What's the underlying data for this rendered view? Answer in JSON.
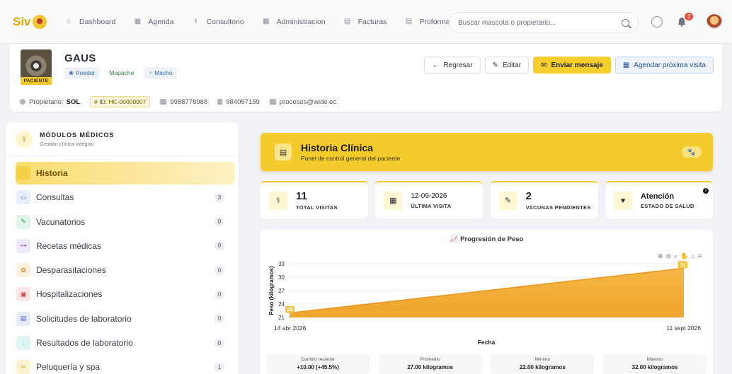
{
  "app": {
    "logo_text": "Siv"
  },
  "nav": {
    "items": [
      {
        "label": "Dashboard",
        "icon": "home-icon"
      },
      {
        "label": "Agenda",
        "icon": "calendar-icon"
      },
      {
        "label": "Consultorio",
        "icon": "doctor-icon"
      },
      {
        "label": "Administracion",
        "icon": "grid-icon"
      },
      {
        "label": "Facturas",
        "icon": "file-icon"
      },
      {
        "label": "Proformas",
        "icon": "file-icon"
      }
    ],
    "search_placeholder": "Buscar mascota o propietario...",
    "notifications_count": "2"
  },
  "patient": {
    "name": "GAUS",
    "tag": "PACIENTE",
    "chips": {
      "species": "Roedor",
      "breed": "Mapache",
      "sex": "Macho"
    },
    "owner_label": "Propietario:",
    "owner_name": "SOL",
    "id": "ID: HC-00000007",
    "phone1": "9988778988",
    "phone2": "984057159",
    "email": "procesos@wide.ec"
  },
  "actions": {
    "back": "Regresar",
    "edit": "Editar",
    "message": "Enviar mensaje",
    "schedule": "Agendar próxima visita"
  },
  "sidebar": {
    "title": "MÓDULOS MÉDICOS",
    "subtitle": "Gestión clínica integral",
    "items": [
      {
        "label": "Historia",
        "count": "",
        "color": "#f3cb2c",
        "bg": "#f6d24a"
      },
      {
        "label": "Consultas",
        "count": "3",
        "color": "#3f6fd1",
        "bg": "#e7eefc"
      },
      {
        "label": "Vacunatorios",
        "count": "0",
        "color": "#2e9d5b",
        "bg": "#e3f5ea"
      },
      {
        "label": "Recetas médicas",
        "count": "0",
        "color": "#7a4fd0",
        "bg": "#efe8fb"
      },
      {
        "label": "Desparasitaciones",
        "count": "0",
        "color": "#d98a1c",
        "bg": "#fdf0de"
      },
      {
        "label": "Hospitalizaciones",
        "count": "0",
        "color": "#d64545",
        "bg": "#fde6e6"
      },
      {
        "label": "Solicitudes de laboratorio",
        "count": "0",
        "color": "#4b5fd6",
        "bg": "#e8ebfb"
      },
      {
        "label": "Resultados de laboratorio",
        "count": "0",
        "color": "#2b9fa3",
        "bg": "#e1f4f4"
      },
      {
        "label": "Peluquería y spa",
        "count": "1",
        "color": "#c9a400",
        "bg": "#fbf3cf"
      }
    ]
  },
  "banner": {
    "title": "Historia Clínica",
    "subtitle": "Panel de control general del paciente"
  },
  "stats": [
    {
      "value": "11",
      "label": "TOTAL VISITAS",
      "icon": "stethoscope-icon"
    },
    {
      "value": "12-09-2026",
      "label": "ÚLTIMA VISITA",
      "icon": "calendar-check-icon"
    },
    {
      "value": "2",
      "label": "VACUNAS PENDIENTES",
      "icon": "syringe-icon"
    },
    {
      "value": "Atención",
      "label": "ESTADO DE SALUD",
      "icon": "heart-pulse-icon"
    }
  ],
  "chart_data": {
    "type": "area",
    "title": "Progresión de Peso",
    "xlabel": "Fecha",
    "ylabel": "Peso (kilogramos)",
    "x": [
      "14 abr 2026",
      "11 sept 2026"
    ],
    "series": [
      {
        "values": [
          22,
          32
        ]
      }
    ],
    "data_labels": [
      "22",
      "32"
    ],
    "yticks": [
      21,
      24,
      27,
      30,
      33
    ],
    "ylim": [
      21,
      33
    ],
    "grid": true,
    "color": "#f0a52a"
  },
  "summary": [
    {
      "label": "Cambio reciente",
      "value": "+10.00 (+45.5%)"
    },
    {
      "label": "Promedio",
      "value": "27.00 kilogramos"
    },
    {
      "label": "Mínimo",
      "value": "22.00 kilogramos"
    },
    {
      "label": "Máximo",
      "value": "32.00 kilogramos"
    }
  ]
}
